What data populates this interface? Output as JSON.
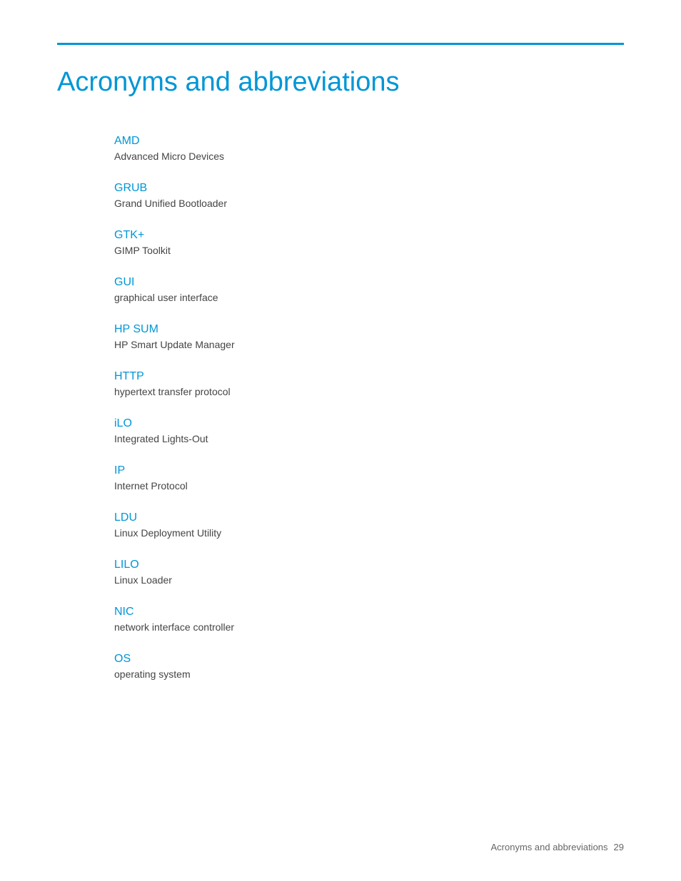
{
  "page": {
    "title": "Acronyms and abbreviations",
    "footer": {
      "label": "Acronyms and abbreviations",
      "page_number": "29"
    }
  },
  "acronyms": [
    {
      "term": "AMD",
      "definition": "Advanced Micro Devices"
    },
    {
      "term": "GRUB",
      "definition": "Grand Unified Bootloader"
    },
    {
      "term": "GTK+",
      "definition": "GIMP Toolkit"
    },
    {
      "term": "GUI",
      "definition": "graphical user interface"
    },
    {
      "term": "HP SUM",
      "definition": "HP Smart Update Manager"
    },
    {
      "term": "HTTP",
      "definition": "hypertext transfer protocol"
    },
    {
      "term": "iLO",
      "definition": "Integrated Lights-Out"
    },
    {
      "term": "IP",
      "definition": "Internet Protocol"
    },
    {
      "term": "LDU",
      "definition": "Linux Deployment Utility"
    },
    {
      "term": "LILO",
      "definition": "Linux Loader"
    },
    {
      "term": "NIC",
      "definition": "network interface controller"
    },
    {
      "term": "OS",
      "definition": "operating system"
    }
  ]
}
